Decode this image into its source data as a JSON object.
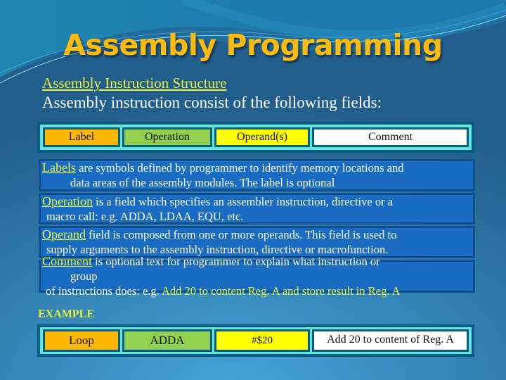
{
  "slide": {
    "title": "Assembly Programming",
    "subtitle": "Assembly Instruction Structure",
    "intro": "Assembly instruction consist of the following fields:"
  },
  "fields_table": {
    "cells": [
      "Label",
      "Operation",
      "Operand(s)",
      "Comment"
    ],
    "colors": [
      "#fdb902",
      "#92d050",
      "#ffff00",
      "#ffffff"
    ]
  },
  "descriptions": [
    {
      "keyword": "Labels",
      "line1": " are symbols defined by programmer to identify memory locations and",
      "line2": "data areas of the assembly modules. The label is optional"
    },
    {
      "keyword": "Operation",
      "line1": " is a field which specifies an assembler instruction, directive or a",
      "line2": "macro call: e.g. ADDA, LDAA, EQU, etc."
    },
    {
      "keyword": "Operand",
      "line1": " field is composed from one or more operands. This field is used to",
      "line2": "supply arguments to the assembly instruction, directive  or macrofunction."
    },
    {
      "keyword": "Comment",
      "line1": " is optional text for programmer to explain what instruction or",
      "line2": "group",
      "line3_prefix": "of instructions does: e.g. ",
      "line3_highlight": "Add 20 to content Reg. A and store result in Reg. A"
    }
  ],
  "example": {
    "label": "EXAMPLE",
    "cells": [
      "Loop",
      "ADDA",
      "#$20",
      "Add 20 to content of Reg. A"
    ]
  },
  "colors": {
    "title": "#fdbb10",
    "highlight": "#e6f23a",
    "frame": "#5ee8d6",
    "frame_border": "#0b5a86",
    "desc_box": "#1a6cc2"
  }
}
